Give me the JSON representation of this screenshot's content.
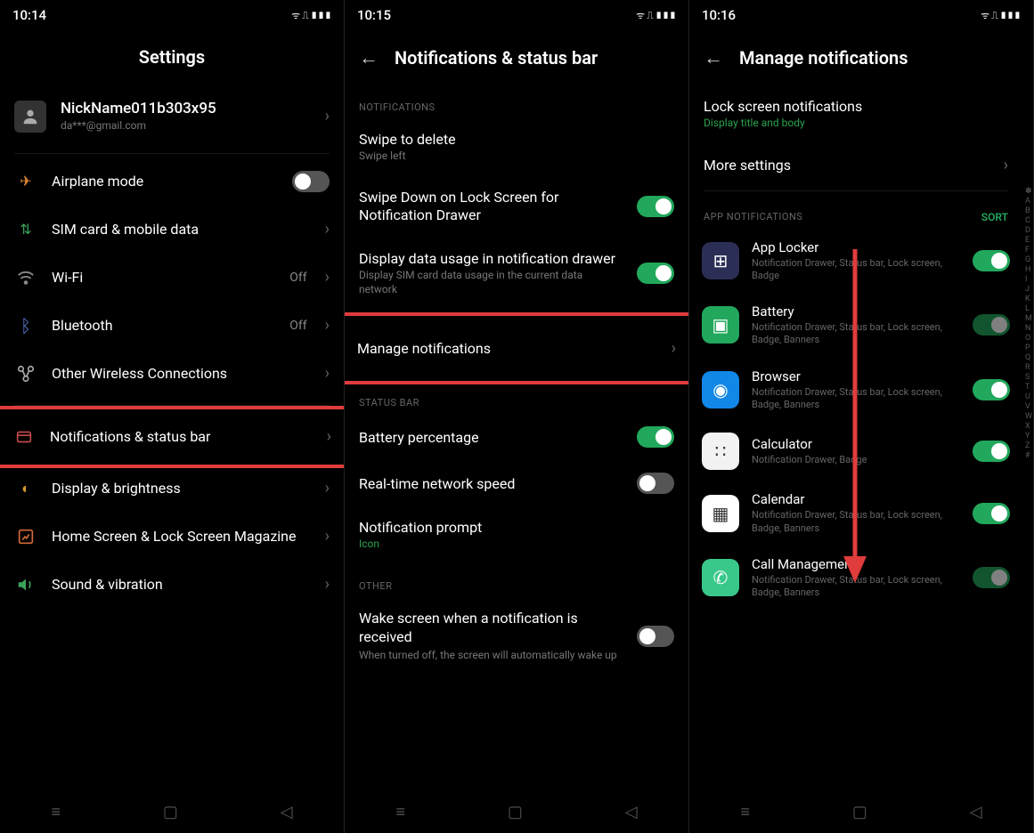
{
  "screens": {
    "s1": {
      "time": "10:14",
      "status_icons": "ᯤ ⎍ ▮▮▮",
      "header": "Settings",
      "profile": {
        "name": "NickName011b303x95",
        "email": "da***@gmail.com"
      },
      "items": {
        "airplane": {
          "label": "Airplane mode"
        },
        "sim": {
          "label": "SIM card & mobile data"
        },
        "wifi": {
          "label": "Wi-Fi",
          "value": "Off"
        },
        "bluetooth": {
          "label": "Bluetooth",
          "value": "Off"
        },
        "other": {
          "label": "Other Wireless Connections"
        },
        "notif": {
          "label": "Notifications & status bar"
        },
        "display": {
          "label": "Display & brightness"
        },
        "home": {
          "label": "Home Screen & Lock Screen Magazine"
        },
        "sound": {
          "label": "Sound & vibration"
        }
      }
    },
    "s2": {
      "time": "10:15",
      "status_icons": "ᯤ ⎍ ▮▮▮",
      "header": "Notifications & status bar",
      "sections": {
        "notifications": "NOTIFICATIONS",
        "statusbar": "STATUS BAR",
        "other": "OTHER"
      },
      "items": {
        "swipe_delete": {
          "label": "Swipe to delete",
          "sub": "Swipe left"
        },
        "swipe_down": {
          "label": "Swipe Down on Lock Screen for Notification Drawer"
        },
        "data_usage": {
          "label": "Display data usage in notification drawer",
          "sub": "Display SIM card data usage in the current data network"
        },
        "manage": {
          "label": "Manage notifications"
        },
        "battery_pct": {
          "label": "Battery percentage"
        },
        "net_speed": {
          "label": "Real-time network speed"
        },
        "prompt": {
          "label": "Notification prompt",
          "sub": "Icon"
        },
        "wake": {
          "label": "Wake screen when a notification is received",
          "sub": "When turned off, the screen will automatically wake up"
        }
      }
    },
    "s3": {
      "time": "10:16",
      "status_icons": "ᯤ ⎍ ▮▮▮",
      "header": "Manage notifications",
      "lock": {
        "label": "Lock screen notifications",
        "sub": "Display title and body"
      },
      "more": {
        "label": "More settings"
      },
      "section_label": "APP NOTIFICATIONS",
      "sort": "SORT",
      "apps": [
        {
          "name": "App Locker",
          "sub": "Notification Drawer, Status bar, Lock screen, Badge",
          "color": "#2b2f55",
          "glyph": "⊞",
          "on": true
        },
        {
          "name": "Battery",
          "sub": "Notification Drawer, Status bar, Lock screen, Badge, Banners",
          "color": "#22a85c",
          "glyph": "▣",
          "on": true,
          "dim": true
        },
        {
          "name": "Browser",
          "sub": "Notification Drawer, Status bar, Lock screen, Badge, Banners",
          "color": "#1187e8",
          "glyph": "◉",
          "on": true
        },
        {
          "name": "Calculator",
          "sub": "Notification Drawer, Badge",
          "color": "#f2f2f2",
          "glyph": "∷",
          "on": true,
          "dark": true
        },
        {
          "name": "Calendar",
          "sub": "Notification Drawer, Status bar, Lock screen, Badge, Banners",
          "color": "#ffffff",
          "glyph": "▦",
          "on": true,
          "dark": true
        },
        {
          "name": "Call Management",
          "sub": "Notification Drawer, Status bar, Lock screen, Badge, Banners",
          "color": "#3ac88a",
          "glyph": "✆",
          "on": true,
          "dim": true
        }
      ],
      "alpha": [
        "✽",
        "A",
        "B",
        "C",
        "D",
        "E",
        "F",
        "G",
        "H",
        "I",
        "J",
        "K",
        "L",
        "M",
        "N",
        "O",
        "P",
        "Q",
        "R",
        "S",
        "T",
        "U",
        "V",
        "W",
        "X",
        "Y",
        "Z",
        "#"
      ]
    }
  }
}
